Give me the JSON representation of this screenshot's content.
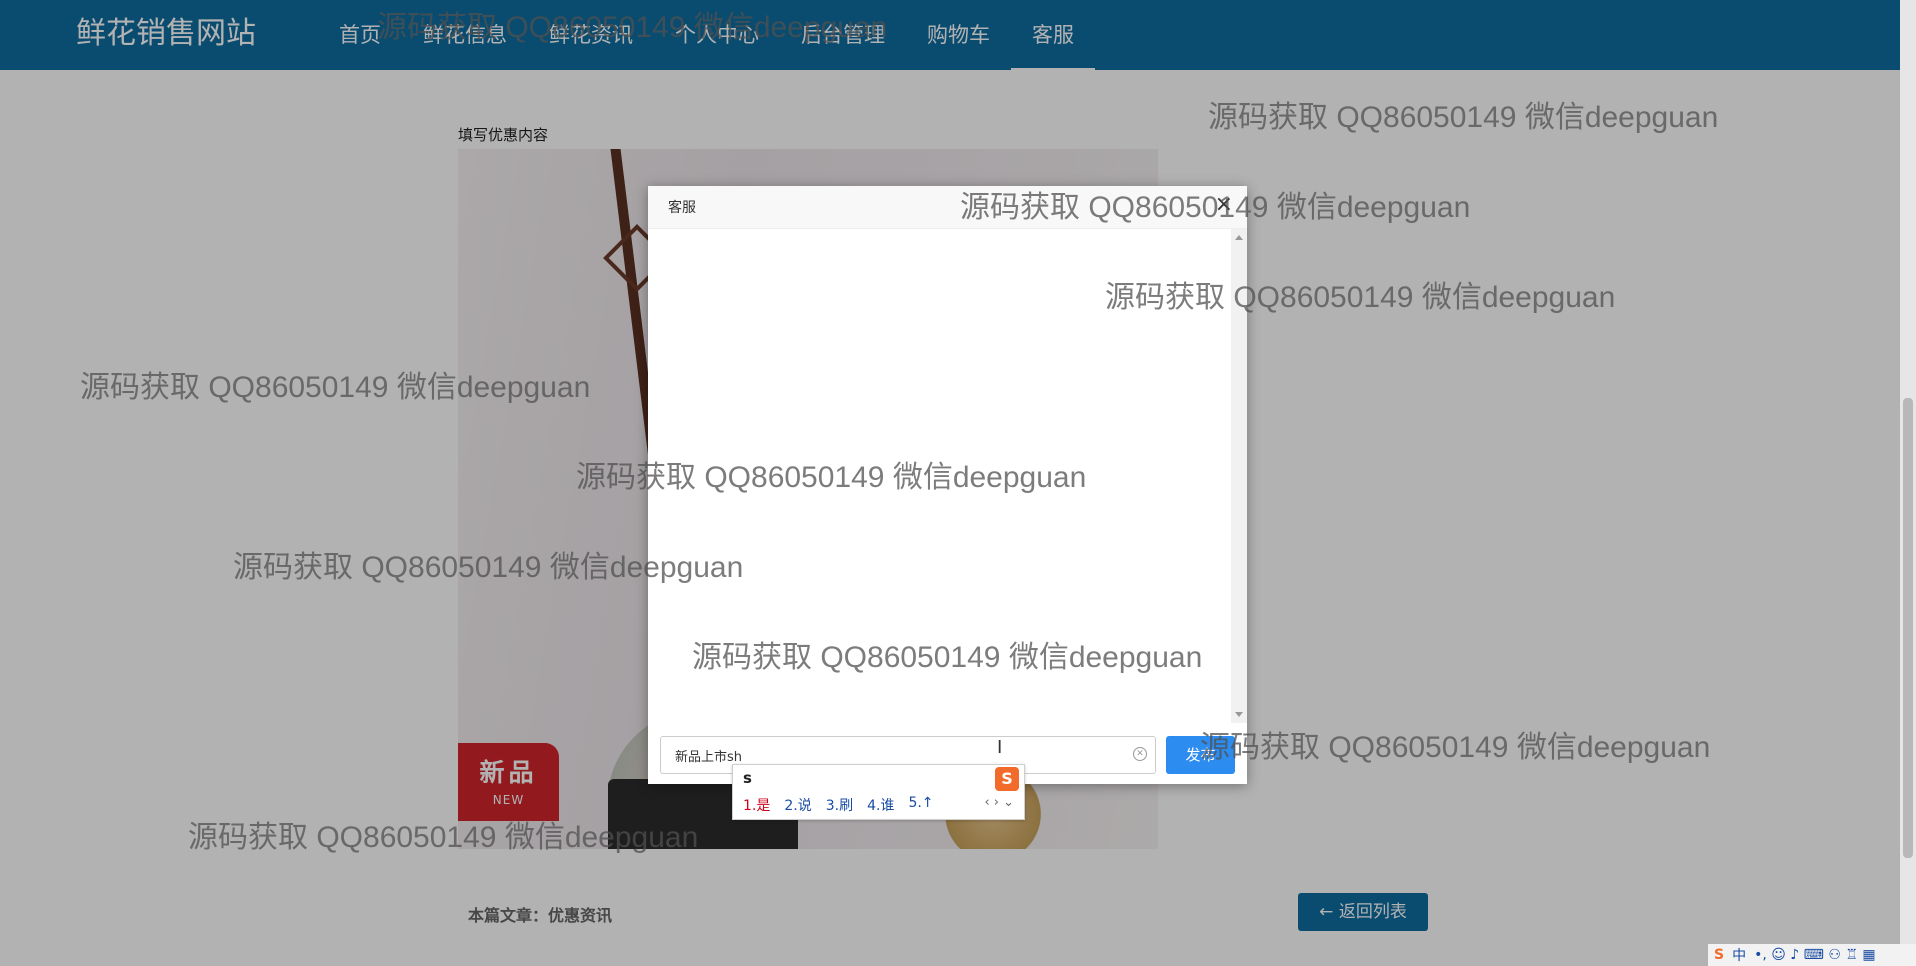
{
  "navbar": {
    "brand": "鲜花销售网站",
    "items": [
      "首页",
      "鲜花信息",
      "鲜花资讯",
      "个人中心",
      "后台管理",
      "购物车",
      "客服"
    ],
    "active": "客服"
  },
  "page": {
    "section_label": "填写优惠内容",
    "badge_cn": "新品",
    "badge_en": "NEW",
    "footer_label": "本篇文章：优惠资讯",
    "back_button": "← 返回列表"
  },
  "modal": {
    "title": "客服",
    "close": "×",
    "input_value": "新品上市sh",
    "send_label": "发布"
  },
  "ime": {
    "pinyin": "s",
    "logo": "S",
    "candidates": [
      "1.是",
      "2.说",
      "3.刷",
      "4.谁",
      "5.↑"
    ],
    "nav": "‹ › ⌄"
  },
  "watermark": "源码获取 QQ86050149 微信deepguan",
  "tray": {
    "logo": "S",
    "lang": "中",
    "icons": "•, ☺ ♪ ⌨ ⚇ ♖ ▦"
  },
  "colors": {
    "navbar": "#0e6da1",
    "send": "#2d8cf0",
    "badge": "#d2252b"
  }
}
